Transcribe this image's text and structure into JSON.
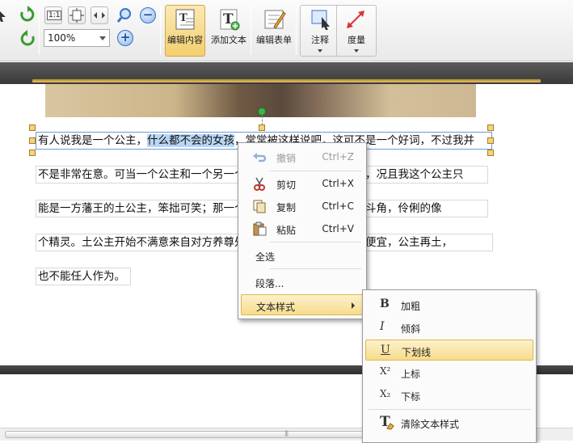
{
  "toolbar": {
    "zoom_value": "100%",
    "actual_size_label": "1:1",
    "buttons": {
      "edit_content": "编辑内容",
      "add_text": "添加文本",
      "edit_form": "编辑表单",
      "annotate": "注释",
      "measure": "度量"
    }
  },
  "document": {
    "lines": [
      {
        "before": "有人说我是一个公主，",
        "selected": "什么都不会的女孩",
        "after": "，常常被这样说吧，这可不是一个好词，不过我并"
      },
      {
        "text": "不是非常在意。可当一个公主和一个另一个公主相比，结果可想而知，况且我这个公主只"
      },
      {
        "text": "能是一方藩王的土公主，笨拙可笑；那一个公主精明能干，深谙勾心斗角，伶俐的像"
      },
      {
        "text": "个精灵。土公主开始不满意来自对方养尊处优，不甘心总是上当的占便宜，公主再土，"
      },
      {
        "text": "也不能任人作为。"
      }
    ]
  },
  "context_menu": {
    "items": [
      {
        "label": "撤销",
        "shortcut": "Ctrl+Z"
      },
      {
        "label": "剪切",
        "shortcut": "Ctrl+X"
      },
      {
        "label": "复制",
        "shortcut": "Ctrl+C"
      },
      {
        "label": "粘贴",
        "shortcut": "Ctrl+V"
      },
      {
        "label": "全选"
      },
      {
        "label": "段落..."
      },
      {
        "label": "文本样式"
      }
    ]
  },
  "text_style_menu": {
    "items": [
      {
        "label": "加粗",
        "glyph": "B"
      },
      {
        "label": "倾斜",
        "glyph": "I"
      },
      {
        "label": "下划线",
        "glyph": "U"
      },
      {
        "label": "上标",
        "glyph": "X²"
      },
      {
        "label": "下标",
        "glyph": "X₂"
      },
      {
        "label": "清除文本样式",
        "glyph": "T"
      }
    ]
  },
  "colors": {
    "active_button": "#f3cf6d",
    "selection": "#b9d6f5",
    "menu_highlight": "#f7dc8c"
  }
}
